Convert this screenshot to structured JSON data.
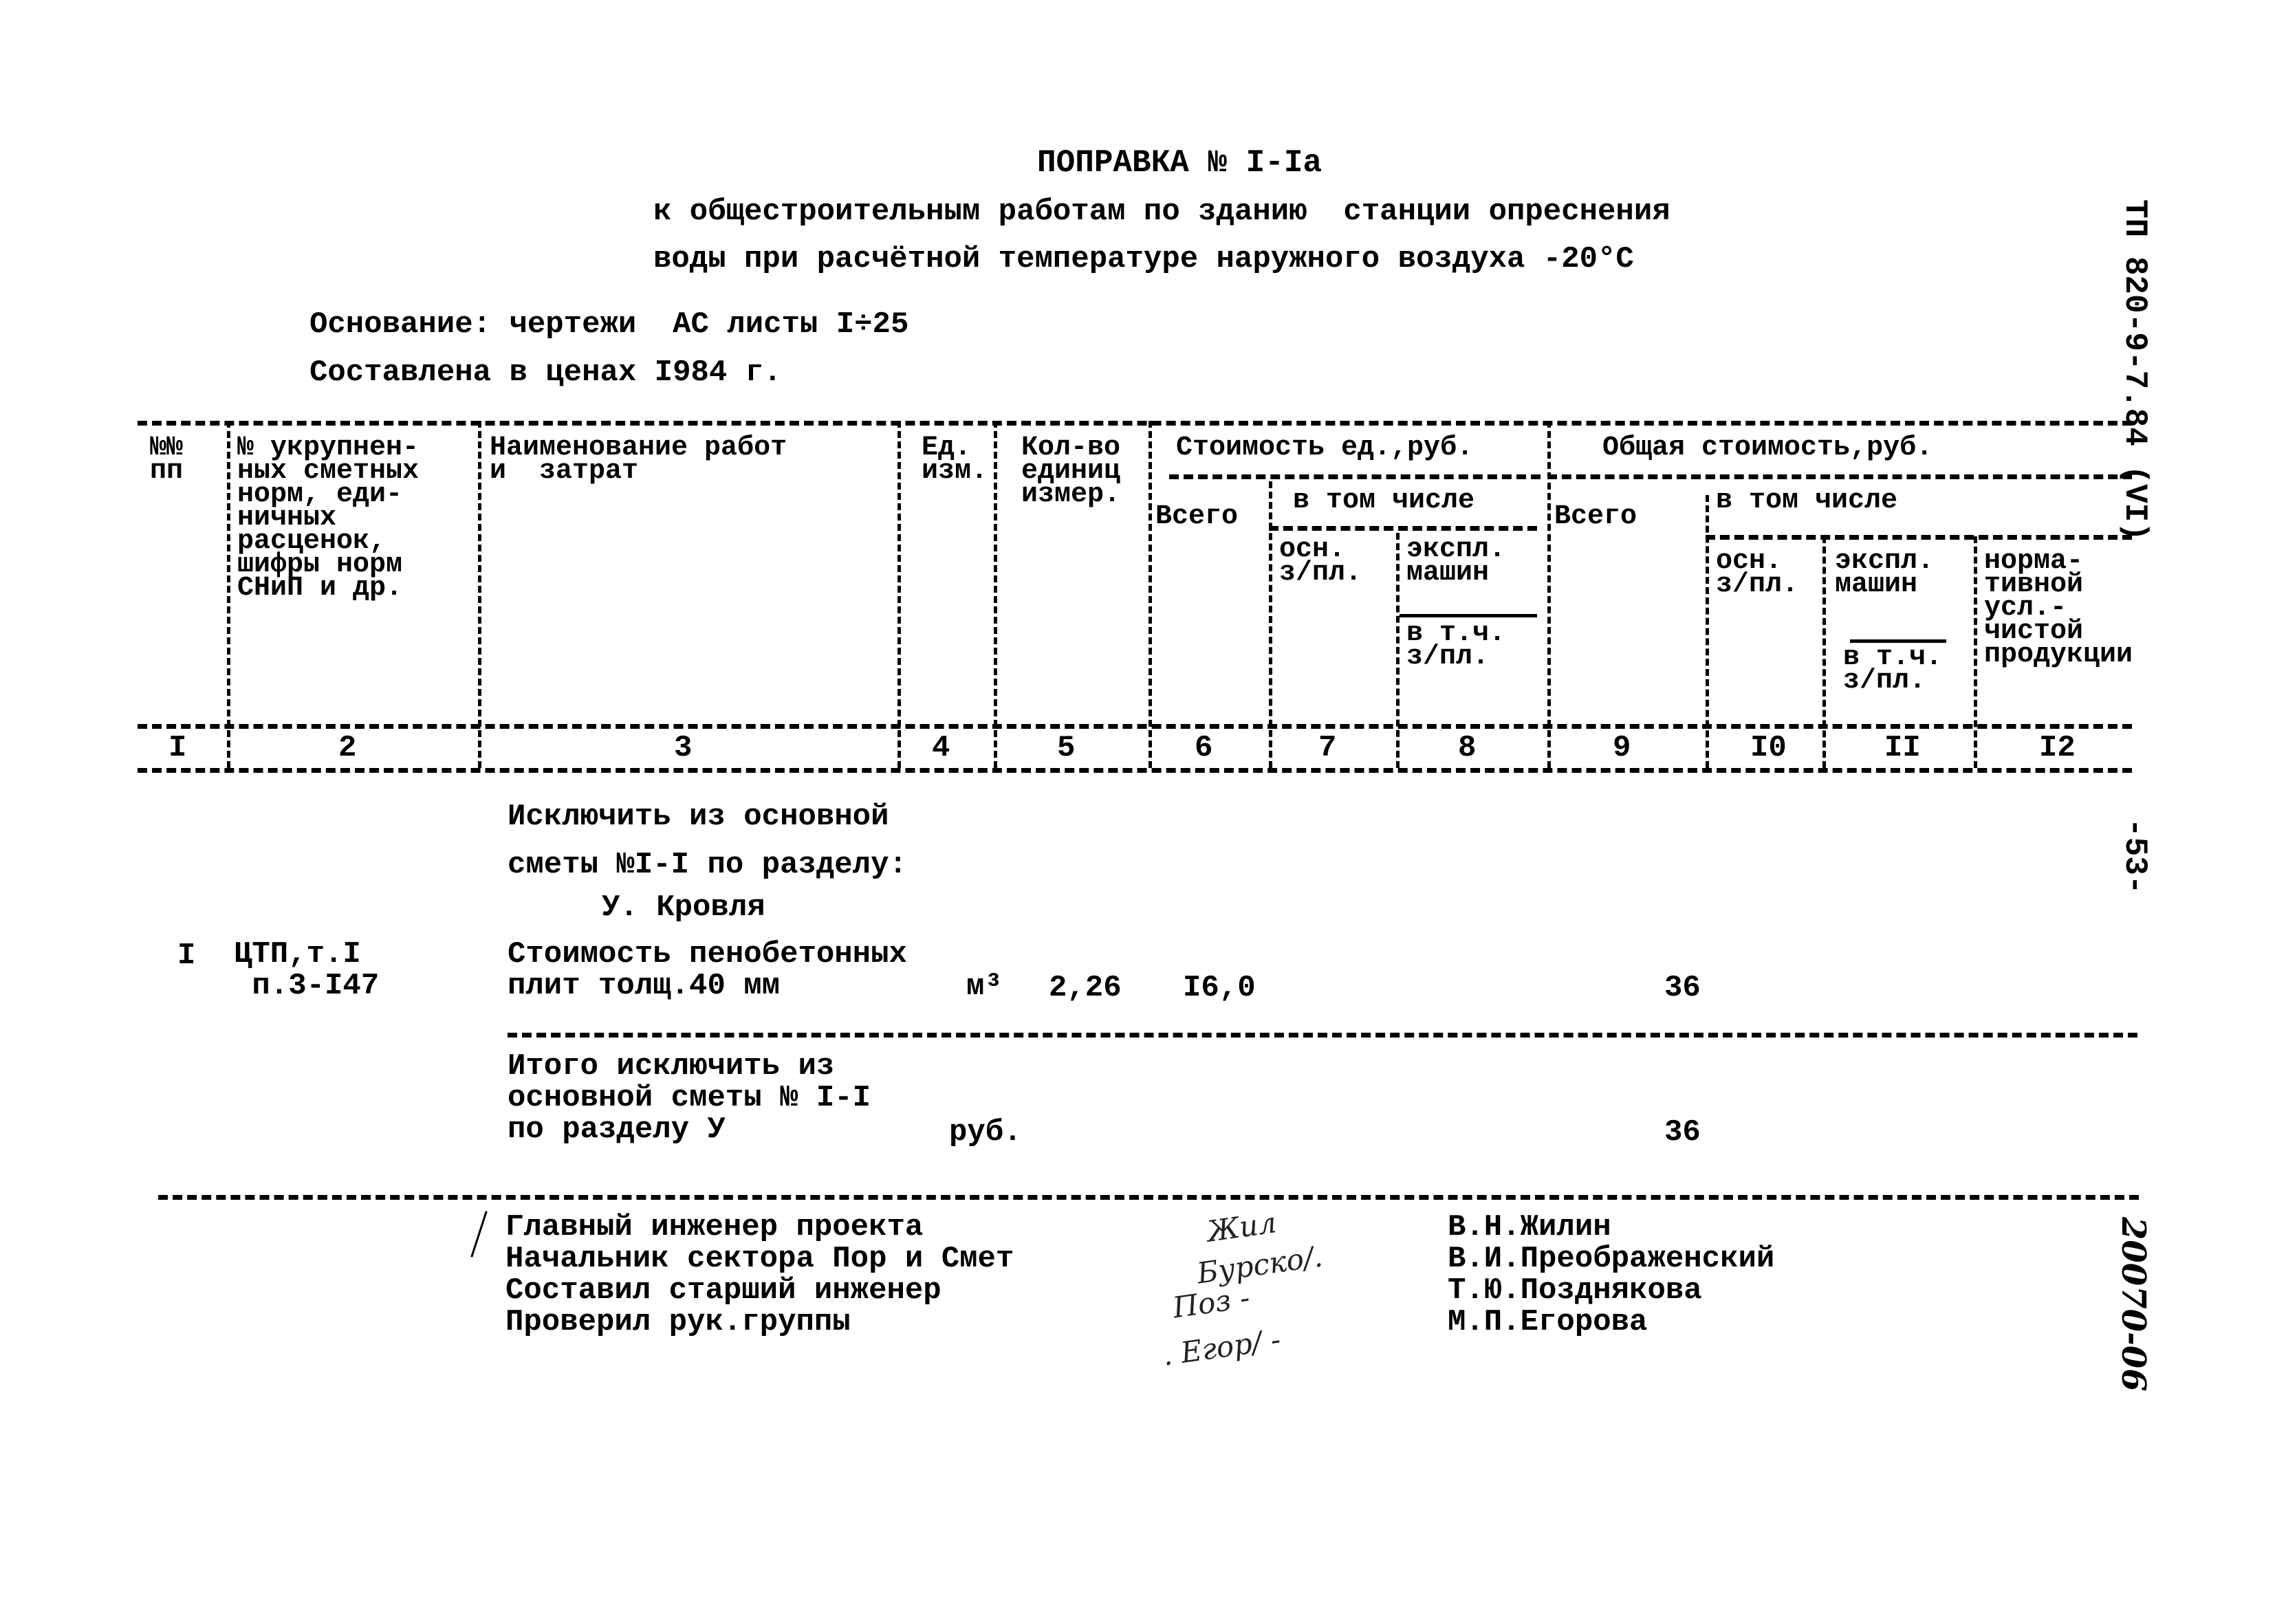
{
  "header": {
    "title": "ПОПРАВКА № I-Iа",
    "subtitle_line1": "к общестроительным работам по зданию  станции опреснения",
    "subtitle_line2": "воды при расчётной температуре наружного воздуха -20°С",
    "basis": "Основание: чертежи  АС листы I÷25",
    "prices": "Составлена в ценах I984 г."
  },
  "side_labels": {
    "doc_code": "ТП 820-9-7.84 (VI)",
    "page": "-53-",
    "archive": "20070-06"
  },
  "table": {
    "columns": {
      "c1": "№№\nпп",
      "c2": "№ укрупнен-\nных сметных\nнорм, еди-\nничных\nрасценок,\nшифры норм\nСНиП и др.",
      "c3": "Наименование работ\nи  затрат",
      "c4": "Ед.\nизм.",
      "c5": "Кол-во\nединиц\nизмер.",
      "unit_cost_group": "Стоимость ед.,руб.",
      "c6": "Всего",
      "unit_incl_group": "в том числе",
      "c7": "осн.\nз/пл.",
      "c8a": "экспл.\nмашин",
      "c8b": "в т.ч.\nз/пл.",
      "total_cost_group": "Общая стоимость,руб.",
      "c9": "Всего",
      "total_incl_group": "в том числе",
      "c10": "осн.\nз/пл.",
      "c11a": "экспл.\nмашин",
      "c11b": "в т.ч.\nз/пл.",
      "c12": "норма-\nтивной\nусл.-\nчистой\nпродукции"
    },
    "column_numbers": [
      "I",
      "2",
      "3",
      "4",
      "5",
      "6",
      "7",
      "8",
      "9",
      "I0",
      "II",
      "I2"
    ],
    "section_intro": "Исключить из основной\nсметы №I-I по разделу:",
    "section_name": "У. Кровля",
    "rows": [
      {
        "num": "I",
        "code": "ЦТП,т.I\n п.3-I47",
        "name": "Стоимость пенобетонных\nплит толщ.40 мм",
        "unit": "м³",
        "qty": "2,26",
        "unit_cost_total": "I6,0",
        "total_cost": "36"
      }
    ],
    "total": {
      "label": "Итого исключить из\nосновной сметы № I-I\nпо разделу У",
      "unit": "руб.",
      "value": "36"
    }
  },
  "signatures": [
    {
      "role": "Главный инженер проекта",
      "name": "В.Н.Жилин"
    },
    {
      "role": "Начальник сектора Пор и Смет",
      "name": "В.И.Преображенский"
    },
    {
      "role": "Составил старший инженер",
      "name": "Т.Ю.Позднякова"
    },
    {
      "role": "Проверил рук.группы",
      "name": "М.П.Егорова"
    }
  ]
}
